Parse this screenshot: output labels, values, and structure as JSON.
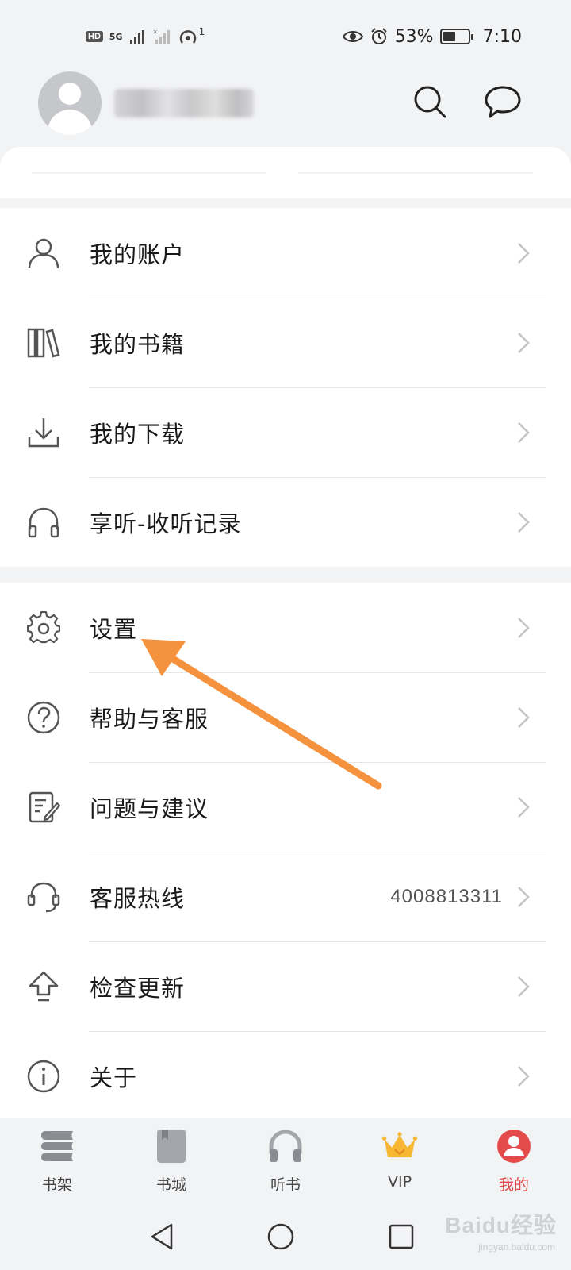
{
  "status_bar": {
    "network_badge": "HD",
    "network_type": "5G",
    "hotspot_count": "1",
    "battery": "53%",
    "battery_level": 53,
    "time": "7:10"
  },
  "menu_group_1": [
    {
      "label": "我的账户",
      "icon": "user-icon"
    },
    {
      "label": "我的书籍",
      "icon": "books-icon"
    },
    {
      "label": "我的下载",
      "icon": "download-icon"
    },
    {
      "label": "享听-收听记录",
      "icon": "headphones-icon"
    }
  ],
  "menu_group_2": [
    {
      "label": "设置",
      "icon": "gear-icon"
    },
    {
      "label": "帮助与客服",
      "icon": "help-icon"
    },
    {
      "label": "问题与建议",
      "icon": "feedback-icon"
    },
    {
      "label": "客服热线",
      "icon": "headset-icon",
      "value": "4008813311"
    },
    {
      "label": "检查更新",
      "icon": "upload-arrow-icon"
    },
    {
      "label": "关于",
      "icon": "info-icon"
    }
  ],
  "bottom_nav": [
    {
      "label": "书架",
      "icon": "bookshelf-icon"
    },
    {
      "label": "书城",
      "icon": "bookstore-icon"
    },
    {
      "label": "听书",
      "icon": "listen-icon"
    },
    {
      "label": "VIP",
      "icon": "crown-icon"
    },
    {
      "label": "我的",
      "icon": "profile-icon",
      "active": true
    }
  ],
  "watermark": {
    "logo": "Baidu经验",
    "url": "jingyan.baidu.com"
  },
  "colors": {
    "accent_red": "#e54b4b",
    "arrow_orange": "#f5923e",
    "crown_gold": "#f7b733"
  }
}
